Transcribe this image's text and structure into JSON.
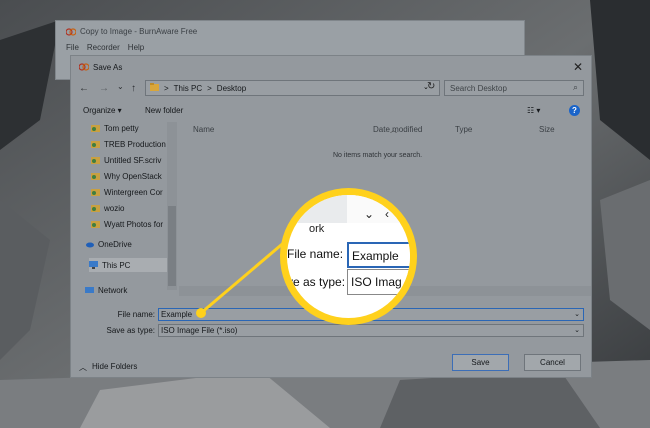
{
  "background_window": {
    "title": "Copy to Image - BurnAware Free",
    "menu": [
      "File",
      "Recorder",
      "Help"
    ]
  },
  "dialog": {
    "title": "Save As",
    "close_glyph": "✕",
    "nav": {
      "back": "←",
      "forward": "→",
      "dropdown": "⌄",
      "up": "↑"
    },
    "breadcrumb": [
      "This PC",
      "Desktop"
    ],
    "breadcrumb_sep": ">",
    "search_placeholder": "Search Desktop",
    "toolbar": {
      "organize": "Organize ▾",
      "new_folder": "New folder",
      "help": "?",
      "view": "☷ ▾"
    },
    "nav_items": [
      "Tom petty",
      "TREB Production",
      "Untitled SF.scriv",
      "Why OpenStack",
      "Wintergreen Cor",
      "wozio",
      "Wyatt Photos for",
      "OneDrive",
      "This PC",
      "Network"
    ],
    "columns": [
      "Name",
      "Date modified",
      "Type",
      "Size"
    ],
    "empty_message": "No items match your search.",
    "file_name_label": "File name:",
    "file_name_value": "Example",
    "save_type_label": "Save as type:",
    "save_type_value": "ISO Image File (*.iso)",
    "hide_folders": "Hide Folders",
    "hide_glyph": "︿",
    "save_button": "Save",
    "cancel_button": "Cancel"
  },
  "magnifier": {
    "fragment": "ork",
    "file_name_label": "File name:",
    "file_name_value": "Example",
    "save_type_label": "ve as type:",
    "save_type_value": "ISO Imag"
  },
  "colors": {
    "highlight": "#ffd11c",
    "accent": "#2a66b5"
  }
}
